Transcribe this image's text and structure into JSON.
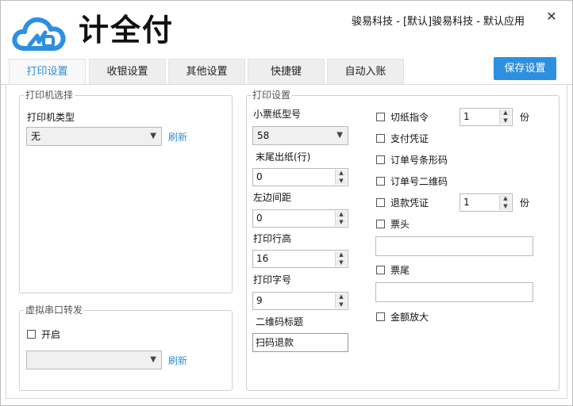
{
  "window": {
    "title": "骏易科技 - [默认]骏易科技 - 默认应用",
    "close_glyph": "✕",
    "logo_text": "计全付"
  },
  "tabs": [
    {
      "label": "打印设置",
      "active": true
    },
    {
      "label": "收银设置",
      "active": false
    },
    {
      "label": "其他设置",
      "active": false
    },
    {
      "label": "快捷键",
      "active": false
    },
    {
      "label": "自动入账",
      "active": false
    }
  ],
  "save_button": "保存设置",
  "printer_select": {
    "legend": "打印机选择",
    "type_label": "打印机类型",
    "type_value": "无",
    "refresh": "刷新"
  },
  "serial_forward": {
    "legend": "虚拟串口转发",
    "enable_label": "开启",
    "port_value": "",
    "refresh": "刷新"
  },
  "print_settings": {
    "legend": "打印设置",
    "paper_model_label": "小票纸型号",
    "paper_model_value": "58",
    "tail_feed_label": "末尾出纸(行)",
    "tail_feed_value": "0",
    "left_margin_label": "左边间距",
    "left_margin_value": "0",
    "line_height_label": "打印行高",
    "line_height_value": "16",
    "font_size_label": "打印字号",
    "font_size_value": "9",
    "qr_title_label": "二维码标题",
    "qr_title_value": "扫码退款",
    "cut_paper_label": "切纸指令",
    "cut_paper_value": "1",
    "copies_unit": "份",
    "pay_voucher_label": "支付凭证",
    "order_barcode_label": "订单号条形码",
    "order_qrcode_label": "订单号二维码",
    "refund_voucher_label": "退款凭证",
    "refund_voucher_value": "1",
    "header_label": "票头",
    "header_value": "",
    "footer_label": "票尾",
    "footer_value": "",
    "amount_enlarge_label": "金额放大"
  },
  "colors": {
    "accent": "#2d8fe0",
    "logo_blue": "#2d8fe0"
  },
  "icons": {
    "logo": "cloud-logo-icon",
    "dropdown": "chevron-down-icon",
    "spinner": "spinner-arrows-icon"
  }
}
